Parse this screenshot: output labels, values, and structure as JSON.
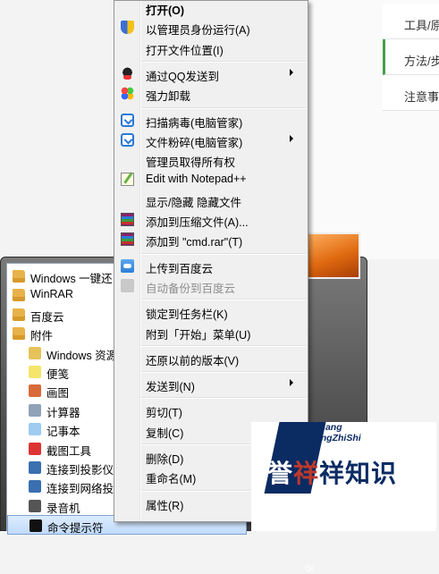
{
  "web_panel": {
    "items": [
      "工具/原",
      "方法/步",
      "注意事"
    ],
    "active_index": 1
  },
  "start_menu": {
    "items": [
      {
        "label": "Windows 一键还",
        "icon": "folder-icon"
      },
      {
        "label": "WinRAR",
        "icon": "folder-icon"
      },
      {
        "label": "百度云",
        "icon": "folder-icon"
      },
      {
        "label": "附件",
        "icon": "folder-icon"
      },
      {
        "label": "Windows 资源",
        "icon": "explorer-icon"
      },
      {
        "label": "便笺",
        "icon": "sticky-note-icon"
      },
      {
        "label": "画图",
        "icon": "paint-icon"
      },
      {
        "label": "计算器",
        "icon": "calculator-icon"
      },
      {
        "label": "记事本",
        "icon": "notepad-icon"
      },
      {
        "label": "截图工具",
        "icon": "snipping-tool-icon"
      },
      {
        "label": "连接到投影仪",
        "icon": "projector-icon"
      },
      {
        "label": "连接到网络投影",
        "icon": "network-projector-icon"
      },
      {
        "label": "录音机",
        "icon": "microphone-icon"
      },
      {
        "label": "命令提示符",
        "icon": "cmd-icon"
      }
    ],
    "selected_index": 13,
    "right_pane_fragment": "or"
  },
  "context_menu": {
    "items": [
      {
        "label": "打开(O)",
        "bold": true
      },
      {
        "label": "以管理员身份运行(A)",
        "icon": "uac-shield-icon"
      },
      {
        "label": "打开文件位置(I)"
      },
      {
        "separator": true
      },
      {
        "label": "通过QQ发送到",
        "icon": "qq-icon",
        "submenu": true
      },
      {
        "label": "强力卸载",
        "icon": "uninstall-flower-icon"
      },
      {
        "separator": true
      },
      {
        "label": "扫描病毒(电脑管家)",
        "icon": "pc-manager-icon"
      },
      {
        "label": "文件粉碎(电脑管家)",
        "icon": "pc-manager-icon",
        "submenu": true
      },
      {
        "label": "管理员取得所有权"
      },
      {
        "label": "Edit with Notepad++",
        "icon": "notepad-plus-icon"
      },
      {
        "label": "显示/隐藏 隐藏文件"
      },
      {
        "label": "添加到压缩文件(A)...",
        "icon": "winrar-icon"
      },
      {
        "label": "添加到 \"cmd.rar\"(T)",
        "icon": "winrar-icon"
      },
      {
        "separator": true
      },
      {
        "label": "上传到百度云",
        "icon": "baidu-cloud-icon"
      },
      {
        "label": "自动备份到百度云",
        "icon": "baidu-cloud-icon",
        "disabled": true
      },
      {
        "separator": true
      },
      {
        "label": "锁定到任务栏(K)"
      },
      {
        "label": "附到「开始」菜单(U)"
      },
      {
        "separator": true
      },
      {
        "label": "还原以前的版本(V)"
      },
      {
        "separator": true
      },
      {
        "label": "发送到(N)",
        "submenu": true
      },
      {
        "separator": true
      },
      {
        "label": "剪切(T)"
      },
      {
        "label": "复制(C)"
      },
      {
        "separator": true
      },
      {
        "label": "删除(D)"
      },
      {
        "label": "重命名(M)"
      },
      {
        "separator": true
      },
      {
        "label": "属性(R)"
      }
    ]
  },
  "watermark": {
    "line1": "YuXiang",
    "line2": "XiangZhiShi",
    "big_a": "誉",
    "big_b": "祥",
    "big_c": "祥知识"
  }
}
